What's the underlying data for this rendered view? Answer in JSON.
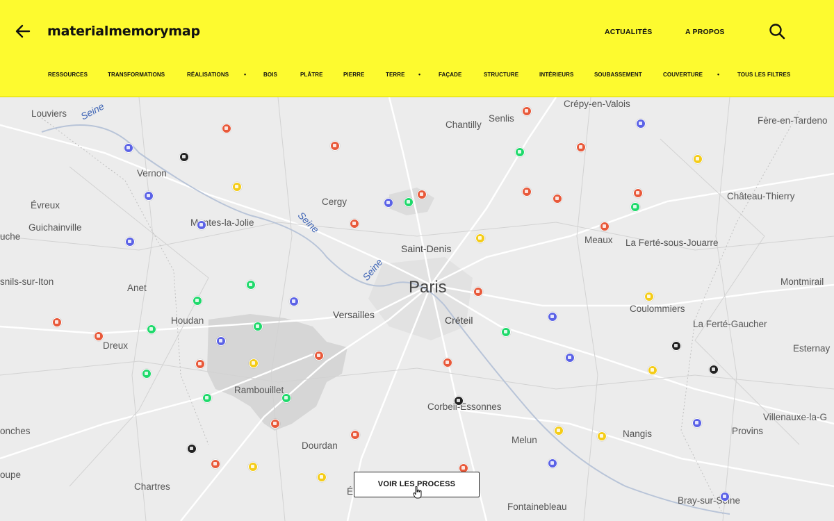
{
  "header": {
    "brand": "materialmemorymap",
    "nav": [
      "ACTUALITÉS",
      "A PROPOS"
    ]
  },
  "filters": {
    "items": [
      "RESSOURCES",
      "TRANSFORMATIONS",
      "RÉALISATIONS",
      "•",
      "BOIS",
      "PLÂTRE",
      "PIERRE",
      "TERRE",
      "•",
      "FAÇADE",
      "STRUCTURE",
      "INTÉRIEURS",
      "SOUBASSEMENT",
      "COUVERTURE",
      "•",
      "TOUS LES FILTRES"
    ]
  },
  "map": {
    "places": [
      "Louviers",
      "Vernon",
      "Évreux",
      "Guichainville",
      "uche",
      "snils-sur-Iton",
      "Anet",
      "Houdan",
      "Dreux",
      "Mantes-la-Jolie",
      "Cergy",
      "Saint-Denis",
      "Paris",
      "Versailles",
      "Créteil",
      "Rambouillet",
      "Dourdan",
      "Chartres",
      "onches",
      "oupe",
      "Chantilly",
      "Senlis",
      "Crépy-en-Valois",
      "Fère-en-Tardeno",
      "Château-Thierry",
      "Meaux",
      "La Ferté-sous-Jouarre",
      "Montmirail",
      "Coulommiers",
      "La Ferté-Gaucher",
      "Esternay",
      "Corbeil-Essonnes",
      "Melun",
      "Nangis",
      "Provins",
      "Villenauxe-la-G",
      "Fontainebleau",
      "Bray-sur-Seine",
      "É"
    ],
    "rivers": [
      "Seine",
      "Seine",
      "Seine"
    ],
    "pin_colors": {
      "red": "#e8593a",
      "blue": "#5b62e6",
      "green": "#1fd96b",
      "yellow": "#f4cc18",
      "black": "#222222"
    }
  },
  "cta": {
    "label": "VOIR LES PROCESS"
  },
  "accent": "#fdfa2f"
}
